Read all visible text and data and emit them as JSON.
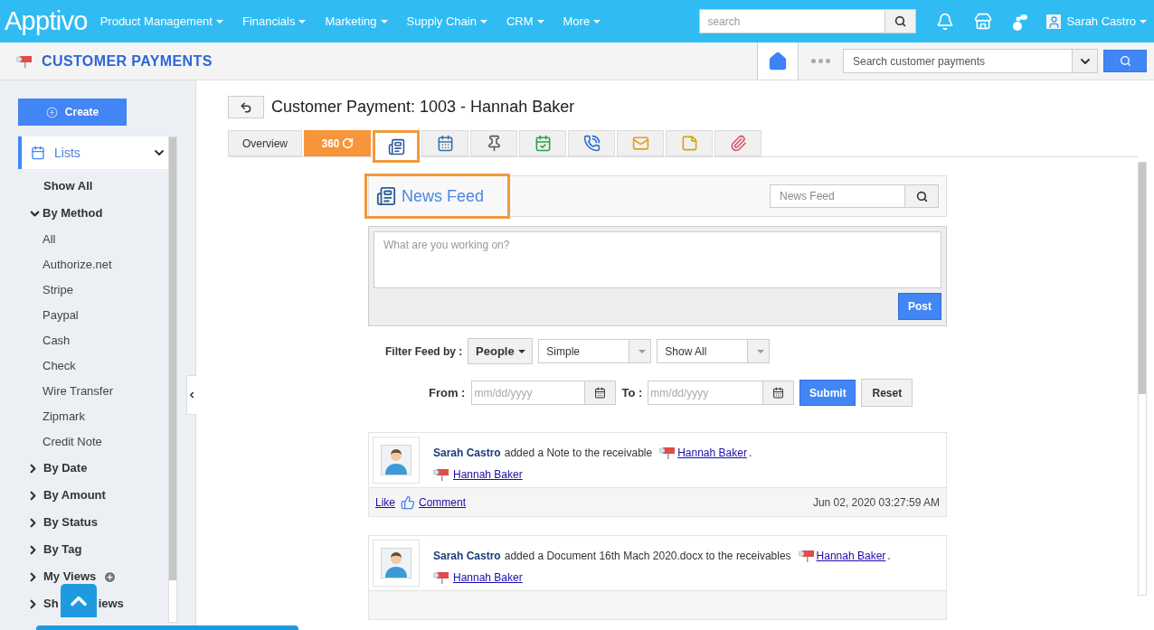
{
  "topbar": {
    "logo": "Apptivo",
    "menu": [
      {
        "label": "Product Management"
      },
      {
        "label": "Financials"
      },
      {
        "label": "Marketing"
      },
      {
        "label": "Supply Chain"
      },
      {
        "label": "CRM"
      },
      {
        "label": "More"
      }
    ],
    "search": {
      "placeholder": "search"
    },
    "user": {
      "name": "Sarah Castro"
    }
  },
  "module": {
    "title": "CUSTOMER PAYMENTS",
    "search": {
      "placeholder": "Search customer payments"
    }
  },
  "sidebar": {
    "create": "Create",
    "lists": {
      "label": "Lists",
      "expanded": true
    },
    "items": [
      {
        "label": "Show All",
        "kind": "plain"
      },
      {
        "label": "By Method",
        "kind": "group",
        "expanded": true,
        "children": [
          {
            "label": "All"
          },
          {
            "label": "Authorize.net"
          },
          {
            "label": "Stripe"
          },
          {
            "label": "Paypal"
          },
          {
            "label": "Cash"
          },
          {
            "label": "Check"
          },
          {
            "label": "Wire Transfer"
          },
          {
            "label": "Zipmark"
          },
          {
            "label": "Credit Note"
          }
        ]
      },
      {
        "label": "By Date",
        "kind": "group",
        "expanded": false
      },
      {
        "label": "By Amount",
        "kind": "group",
        "expanded": false
      },
      {
        "label": "By Status",
        "kind": "group",
        "expanded": false
      },
      {
        "label": "By Tag",
        "kind": "group",
        "expanded": false
      },
      {
        "label": "My Views",
        "kind": "group",
        "expanded": false,
        "addable": true
      },
      {
        "label_parts": [
          "Sh",
          "iews"
        ],
        "kind": "group",
        "expanded": false
      }
    ]
  },
  "record": {
    "title": "Customer Payment: 1003 - Hannah Baker",
    "tabs": [
      {
        "kind": "text",
        "label": "Overview",
        "selected": false
      },
      {
        "kind": "brand",
        "label": "360",
        "selected": false
      },
      {
        "kind": "icon",
        "selected": true
      },
      {
        "kind": "icon",
        "selected": false
      },
      {
        "kind": "icon",
        "selected": false
      },
      {
        "kind": "icon",
        "selected": false
      },
      {
        "kind": "icon",
        "selected": false
      },
      {
        "kind": "icon",
        "selected": false
      },
      {
        "kind": "icon",
        "selected": false
      },
      {
        "kind": "icon",
        "selected": false
      }
    ]
  },
  "newsfeed": {
    "title": "News Feed",
    "highlighted": true,
    "search": {
      "placeholder": "News Feed"
    },
    "composer": {
      "placeholder": "What are you working on?",
      "post": "Post"
    },
    "filter": {
      "label": "Filter Feed by :",
      "people": "People",
      "selects": [
        {
          "value": "Simple"
        },
        {
          "value": "Show All"
        }
      ],
      "from": "From :",
      "from_placeholder": "mm/dd/yyyy",
      "to": "To :",
      "to_placeholder": "mm/dd/yyyy",
      "submit": "Submit",
      "reset": "Reset"
    },
    "posts": [
      {
        "author": "Sarah Castro",
        "action": "added a Note to the receivable",
        "link": "Hannah Baker",
        "end": ".",
        "record_link": "Hannah Baker",
        "like": "Like",
        "comment": "Comment",
        "time": "Jun 02, 2020 03:27:59 AM"
      },
      {
        "author": "Sarah Castro",
        "action": "added a Document 16th Mach 2020.docx to the receivables",
        "link": "Hannah Baker",
        "end": ".",
        "record_link": "Hannah Baker"
      }
    ]
  }
}
